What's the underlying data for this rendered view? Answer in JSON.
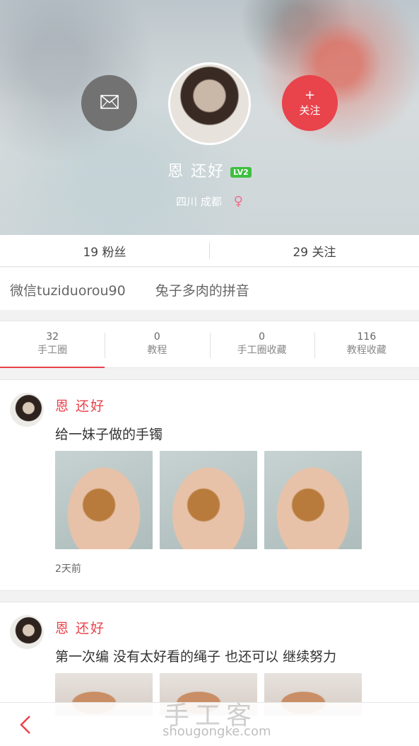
{
  "profile": {
    "name": "恩 还好",
    "level": "LV2",
    "location": "四川 成都",
    "gender_symbol": "♀",
    "follow_plus": "+",
    "follow_label": "关注"
  },
  "stats": {
    "fans": "19 粉丝",
    "following": "29 关注"
  },
  "bio": {
    "wechat": "微信tuziduorou90",
    "note": "兔子多肉的拼音"
  },
  "tabs": [
    {
      "count": "32",
      "label": "手工圈"
    },
    {
      "count": "0",
      "label": "教程"
    },
    {
      "count": "0",
      "label": "手工圈收藏"
    },
    {
      "count": "116",
      "label": "教程收藏"
    }
  ],
  "posts": [
    {
      "author": "恩 还好",
      "text": "给一妹子做的手镯",
      "time": "2天前"
    },
    {
      "author": "恩 还好",
      "text": "第一次编  没有太好看的绳子  也还可以  继续努力"
    }
  ],
  "watermark": {
    "cn": "手工客",
    "en": "shougongke.com"
  },
  "colors": {
    "accent": "#e9434b",
    "level_badge": "#3fbf3f"
  }
}
